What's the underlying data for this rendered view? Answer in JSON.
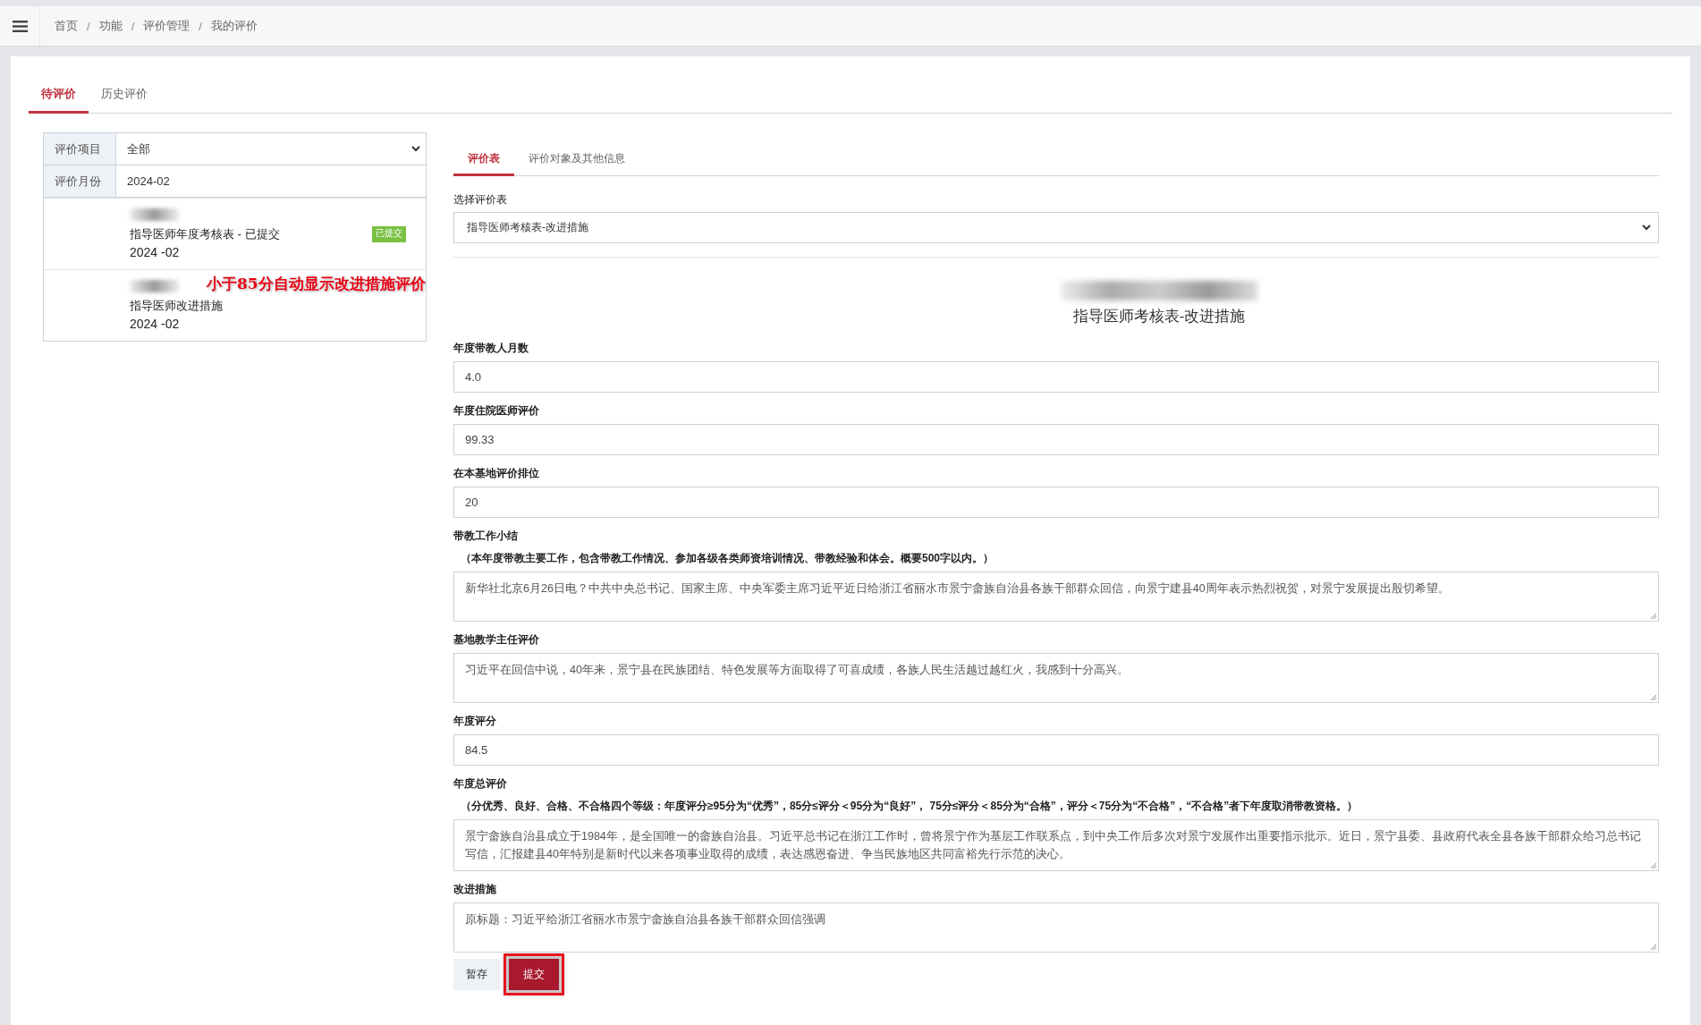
{
  "breadcrumb": [
    "首页",
    "功能",
    "评价管理",
    "我的评价"
  ],
  "breadcrumb_separator": "/",
  "tabs": [
    {
      "label": "待评价",
      "selected": true
    },
    {
      "label": "历史评价",
      "selected": false
    }
  ],
  "filters": [
    {
      "label": "评价项目",
      "value": "全部",
      "kind": "select"
    },
    {
      "label": "评价月份",
      "value": "2024-02",
      "kind": "text"
    }
  ],
  "list_items": [
    {
      "title": "指导医师年度考核表 - 已提交",
      "date": "2024 -02",
      "badge": "已提交"
    },
    {
      "title": "指导医师改进措施",
      "date": "2024 -02"
    }
  ],
  "annotation": "小于85分自动显示改进措施评价",
  "form_tabs": [
    {
      "label": "评价表",
      "selected": true
    },
    {
      "label": "评价对象及其他信息",
      "selected": false
    }
  ],
  "sheet_select": {
    "label": "选择评价表",
    "value": "指导医师考核表-改进措施"
  },
  "form_title": "指导医师考核表-改进措施",
  "fields": [
    {
      "label": "年度带教人月数",
      "value": "4.0",
      "kind": "input"
    },
    {
      "label": "年度住院医师评价",
      "value": "99.33",
      "kind": "input"
    },
    {
      "label": "在本基地评价排位",
      "value": "20",
      "kind": "input"
    },
    {
      "label": "带教工作小结",
      "hint": "（本年度带教主要工作，包含带教工作情况、参加各级各类师资培训情况、带教经验和体会。概要500字以内。）",
      "value": "新华社北京6月26日电？中共中央总书记、国家主席、中央军委主席习近平近日给浙江省丽水市景宁畲族自治县各族干部群众回信，向景宁建县40周年表示热烈祝贺，对景宁发展提出殷切希望。",
      "kind": "textarea"
    },
    {
      "label": "基地教学主任评价",
      "value": "习近平在回信中说，40年来，景宁县在民族团结、特色发展等方面取得了可喜成绩，各族人民生活越过越红火，我感到十分高兴。",
      "kind": "textarea"
    },
    {
      "label": "年度评分",
      "value": "84.5",
      "kind": "input"
    },
    {
      "label": "年度总评价",
      "hint": "（分优秀、良好、合格、不合格四个等级：年度评分≥95分为“优秀”，85分≤评分＜95分为“良好”， 75分≤评分＜85分为“合格”，评分＜75分为“不合格”，“不合格”者下年度取消带教资格。）",
      "value": "景宁畲族自治县成立于1984年，是全国唯一的畲族自治县。习近平总书记在浙江工作时，曾将景宁作为基层工作联系点，到中央工作后多次对景宁发展作出重要指示批示。近日，景宁县委、县政府代表全县各族干部群众给习总书记写信，汇报建县40年特别是新时代以来各项事业取得的成绩，表达感恩奋进、争当民族地区共同富裕先行示范的决心。",
      "kind": "textarea"
    },
    {
      "label": "改进措施",
      "value": "原标题：习近平给浙江省丽水市景宁畲族自治县各族干部群众回信强调",
      "kind": "textarea"
    }
  ],
  "buttons": [
    {
      "label": "暂存",
      "kind": "secondary",
      "highlighted": false
    },
    {
      "label": "提交",
      "kind": "primary",
      "highlighted": true
    }
  ]
}
